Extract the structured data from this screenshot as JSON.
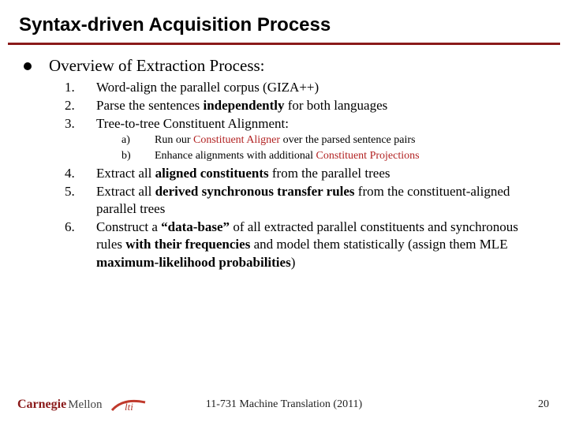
{
  "title": "Syntax-driven Acquisition Process",
  "overview": "Overview of Extraction Process:",
  "items": {
    "n1": "1.",
    "t1": "Word-align the parallel corpus (GIZA++)",
    "n2": "2.",
    "t2a": "Parse the sentences ",
    "t2b": "independently",
    "t2c": " for both languages",
    "n3": "3.",
    "t3": "Tree-to-tree Constituent Alignment:",
    "sa_a": "a)",
    "sa_ta": "Run our ",
    "sa_tb": "Constituent Aligner",
    "sa_tc": " over the parsed sentence pairs",
    "sb_a": "b)",
    "sb_ta": "Enhance alignments with additional ",
    "sb_tb": "Constituent Projections",
    "n4": "4.",
    "t4a": "Extract all ",
    "t4b": "aligned constituents",
    "t4c": " from the parallel trees",
    "n5": "5.",
    "t5a": "Extract all ",
    "t5b": "derived synchronous transfer rules",
    "t5c": " from the constituent-aligned parallel trees",
    "n6": "6.",
    "t6a": "Construct a ",
    "t6b": "“data-base”",
    "t6c": " of all extracted parallel constituents and synchronous rules ",
    "t6d": "with their frequencies",
    "t6e": " and model them statistically (assign them MLE ",
    "t6f": "maximum-likelihood probabilities",
    "t6g": ")"
  },
  "footer": {
    "course": "11-731 Machine Translation (2011)",
    "slide": "20",
    "cm_carnegie": "Carnegie",
    "cm_mellon": "Mellon",
    "lti": "lti"
  }
}
